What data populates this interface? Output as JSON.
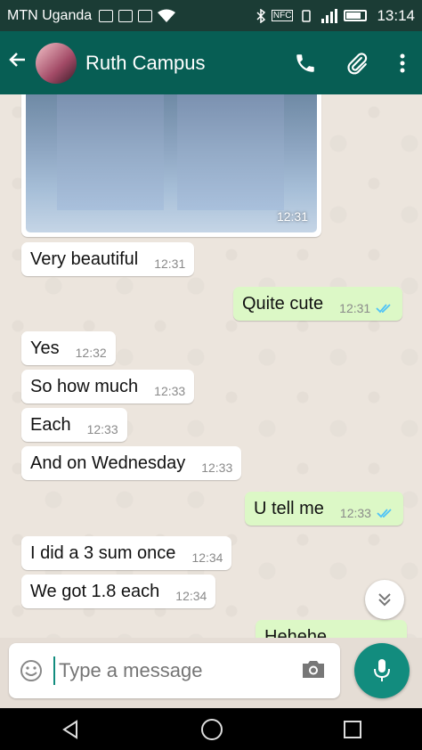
{
  "status_bar": {
    "carrier": "MTN Uganda",
    "time": "13:14",
    "nfc": "NFC"
  },
  "header": {
    "contact_name": "Ruth Campus"
  },
  "image_message": {
    "time": "12:31"
  },
  "messages": [
    {
      "text": "Very beautiful",
      "time": "12:31",
      "direction": "in"
    },
    {
      "text": "Quite cute",
      "time": "12:31",
      "direction": "out",
      "status": "read"
    },
    {
      "text": "Yes",
      "time": "12:32",
      "direction": "in"
    },
    {
      "text": "So how much",
      "time": "12:33",
      "direction": "in"
    },
    {
      "text": "Each",
      "time": "12:33",
      "direction": "in"
    },
    {
      "text": "And on Wednesday",
      "time": "12:33",
      "direction": "in"
    },
    {
      "text": "U tell me",
      "time": "12:33",
      "direction": "out",
      "status": "read"
    },
    {
      "text": "I did a 3 sum once",
      "time": "12:34",
      "direction": "in"
    },
    {
      "text": "We got 1.8 each",
      "time": "12:34",
      "direction": "in"
    },
    {
      "text": "Hehehe",
      "direction": "out"
    }
  ],
  "composer": {
    "placeholder": "Type a message"
  },
  "colors": {
    "header": "#075e54",
    "status_bar": "#1b3c35",
    "outgoing_bubble": "#dcf8c6",
    "accent": "#128c7e",
    "read_ticks": "#4fc3f7"
  }
}
